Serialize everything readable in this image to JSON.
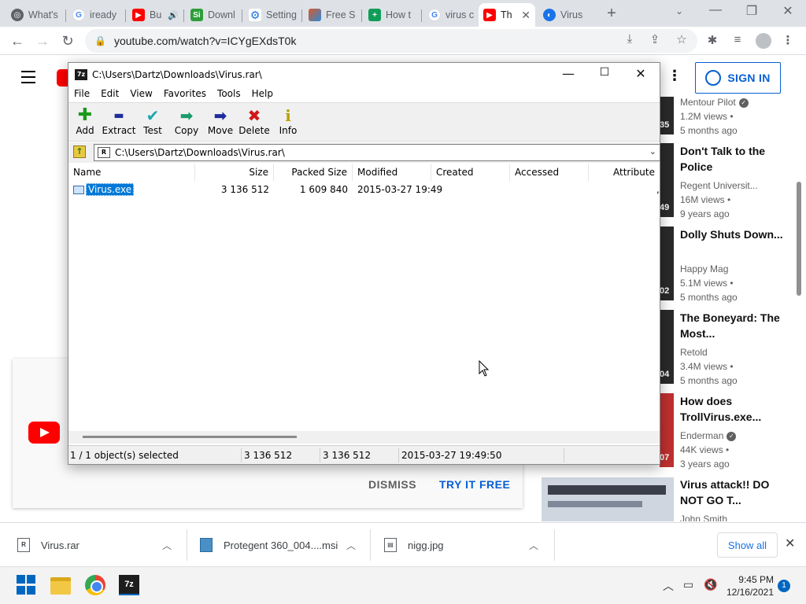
{
  "browser": {
    "tabs": [
      {
        "label": "What's",
        "icon": "chrome-icon",
        "color": "#5f6368"
      },
      {
        "label": "iready",
        "icon": "google-icon",
        "color": "#4285f4"
      },
      {
        "label": "Bu",
        "icon": "youtube-icon",
        "color": "#ff0000"
      },
      {
        "label": "Downl",
        "icon": "si-icon",
        "color": "#2e9e3a"
      },
      {
        "label": "Setting",
        "icon": "settings-gear-icon",
        "color": "#1a73e8"
      },
      {
        "label": "Free S",
        "icon": "free-icon",
        "color": "#d95a2b"
      },
      {
        "label": "How t",
        "icon": "plus-square-icon",
        "color": "#0f9d58"
      },
      {
        "label": "virus c",
        "icon": "google-icon",
        "color": "#4285f4"
      },
      {
        "label": "Th",
        "icon": "youtube-icon",
        "color": "#ff0000"
      },
      {
        "label": "Virus",
        "icon": "virus-site-icon",
        "color": "#1a73e8"
      }
    ],
    "url": "youtube.com/watch?v=ICYgEXdsT0k"
  },
  "youtube": {
    "signin_label": "SIGN IN",
    "promo": {
      "dismiss": "DISMISS",
      "try": "TRY IT FREE"
    },
    "sidebar": [
      {
        "title": "",
        "channel": "Mentour Pilot",
        "verified": true,
        "views": "1.2M views",
        "age": "5 months ago",
        "duration": "35"
      },
      {
        "title": "Don't Talk to the Police",
        "channel": "Regent Universit...",
        "verified": false,
        "views": "16M views",
        "age": "9 years ago",
        "duration": "49"
      },
      {
        "title": "Dolly Shuts Down...",
        "channel": "Happy Mag",
        "verified": false,
        "views": "5.1M views",
        "age": "5 months ago",
        "duration": "02"
      },
      {
        "title": "The Boneyard: The Most...",
        "channel": "Retold",
        "verified": false,
        "views": "3.4M views",
        "age": "5 months ago",
        "duration": "04"
      },
      {
        "title": "How does TrollVirus.exe...",
        "channel": "Enderman",
        "verified": true,
        "views": "44K views",
        "age": "3 years ago",
        "duration": "07"
      },
      {
        "title": "Virus attack!! DO NOT GO T...",
        "channel": "John Smith",
        "verified": false,
        "views": "",
        "age": "",
        "duration": ""
      }
    ]
  },
  "sevenzip": {
    "title": "C:\\Users\\Dartz\\Downloads\\Virus.rar\\",
    "menu": [
      "File",
      "Edit",
      "View",
      "Favorites",
      "Tools",
      "Help"
    ],
    "tools": [
      {
        "label": "Add",
        "icon": "add-plus-icon",
        "glyph": "✚",
        "color": "#1a9a1a"
      },
      {
        "label": "Extract",
        "icon": "extract-minus-icon",
        "glyph": "▬",
        "color": "#1f2c9c"
      },
      {
        "label": "Test",
        "icon": "test-check-icon",
        "glyph": "✔",
        "color": "#1aa6b0"
      },
      {
        "label": "Copy",
        "icon": "copy-arrow-icon",
        "glyph": "➡",
        "color": "#1a9a6a"
      },
      {
        "label": "Move",
        "icon": "move-arrow-icon",
        "glyph": "➡",
        "color": "#1f2c9c"
      },
      {
        "label": "Delete",
        "icon": "delete-x-icon",
        "glyph": "✖",
        "color": "#d01818"
      },
      {
        "label": "Info",
        "icon": "info-icon",
        "glyph": "i",
        "color": "#b8a000"
      }
    ],
    "address": "C:\\Users\\Dartz\\Downloads\\Virus.rar\\",
    "columns": [
      "Name",
      "Size",
      "Packed Size",
      "Modified",
      "Created",
      "Accessed",
      "Attribute"
    ],
    "rows": [
      {
        "name": "Virus.exe",
        "size": "3 136 512",
        "packed": "1 609 840",
        "modified": "2015-03-27 19:49",
        "created": "",
        "accessed": ""
      }
    ],
    "status": {
      "selected": "1 / 1 object(s) selected",
      "size": "3 136 512",
      "packed": "3 136 512",
      "modified": "2015-03-27 19:49:50"
    }
  },
  "downloads": {
    "items": [
      {
        "name": "Virus.rar",
        "icon": "rar-file-icon"
      },
      {
        "name": "Protegent 360_004....msi",
        "icon": "msi-file-icon"
      },
      {
        "name": "nigg.jpg",
        "icon": "image-file-icon"
      }
    ],
    "show_all": "Show all"
  },
  "taskbar": {
    "time": "9:45 PM",
    "date": "12/16/2021",
    "notifications": "1",
    "sz_label": "7z"
  }
}
